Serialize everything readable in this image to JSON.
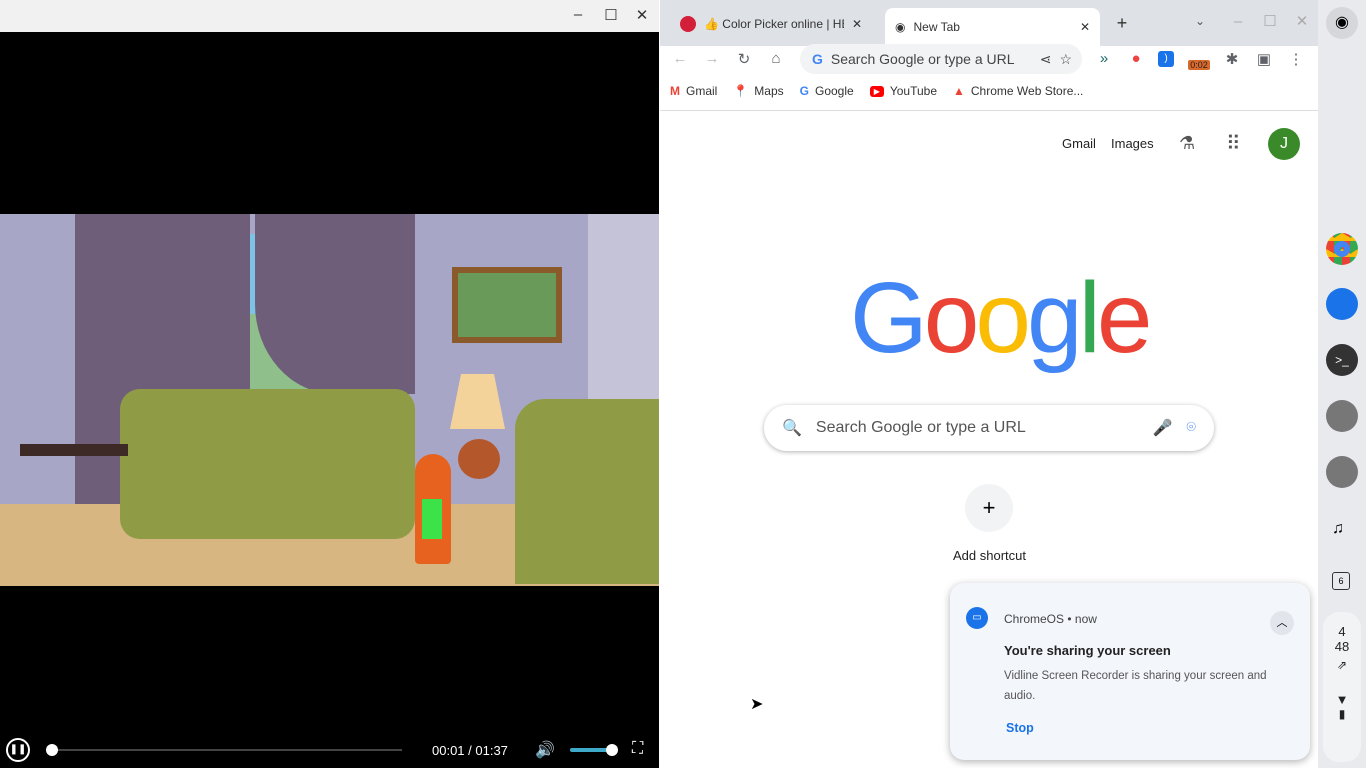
{
  "player": {
    "time": "00:01 / 01:37",
    "progress": 0.01,
    "volume": 0.95
  },
  "browser": {
    "tabs": [
      {
        "label": "👍 Color Picker online | HEX"
      },
      {
        "label": "New Tab"
      }
    ],
    "omnibox_placeholder": "Search Google or type a URL",
    "extension_badge": "0:02",
    "bookmarks": [
      "Gmail",
      "Maps",
      "Google",
      "YouTube",
      "Chrome Web Store..."
    ],
    "ntp": {
      "links": [
        "Gmail",
        "Images"
      ],
      "avatar": "J",
      "logo": "Google",
      "search_placeholder": "Search Google or type a URL",
      "add_shortcut": "Add shortcut"
    }
  },
  "notification": {
    "source": "ChromeOS",
    "time": "now",
    "title": "You're sharing your screen",
    "body": "Vidline Screen Recorder is sharing your screen and audio.",
    "action": "Stop"
  },
  "shelf": {
    "calendar_day": "6",
    "clock_hour": "4",
    "clock_min": "48"
  }
}
